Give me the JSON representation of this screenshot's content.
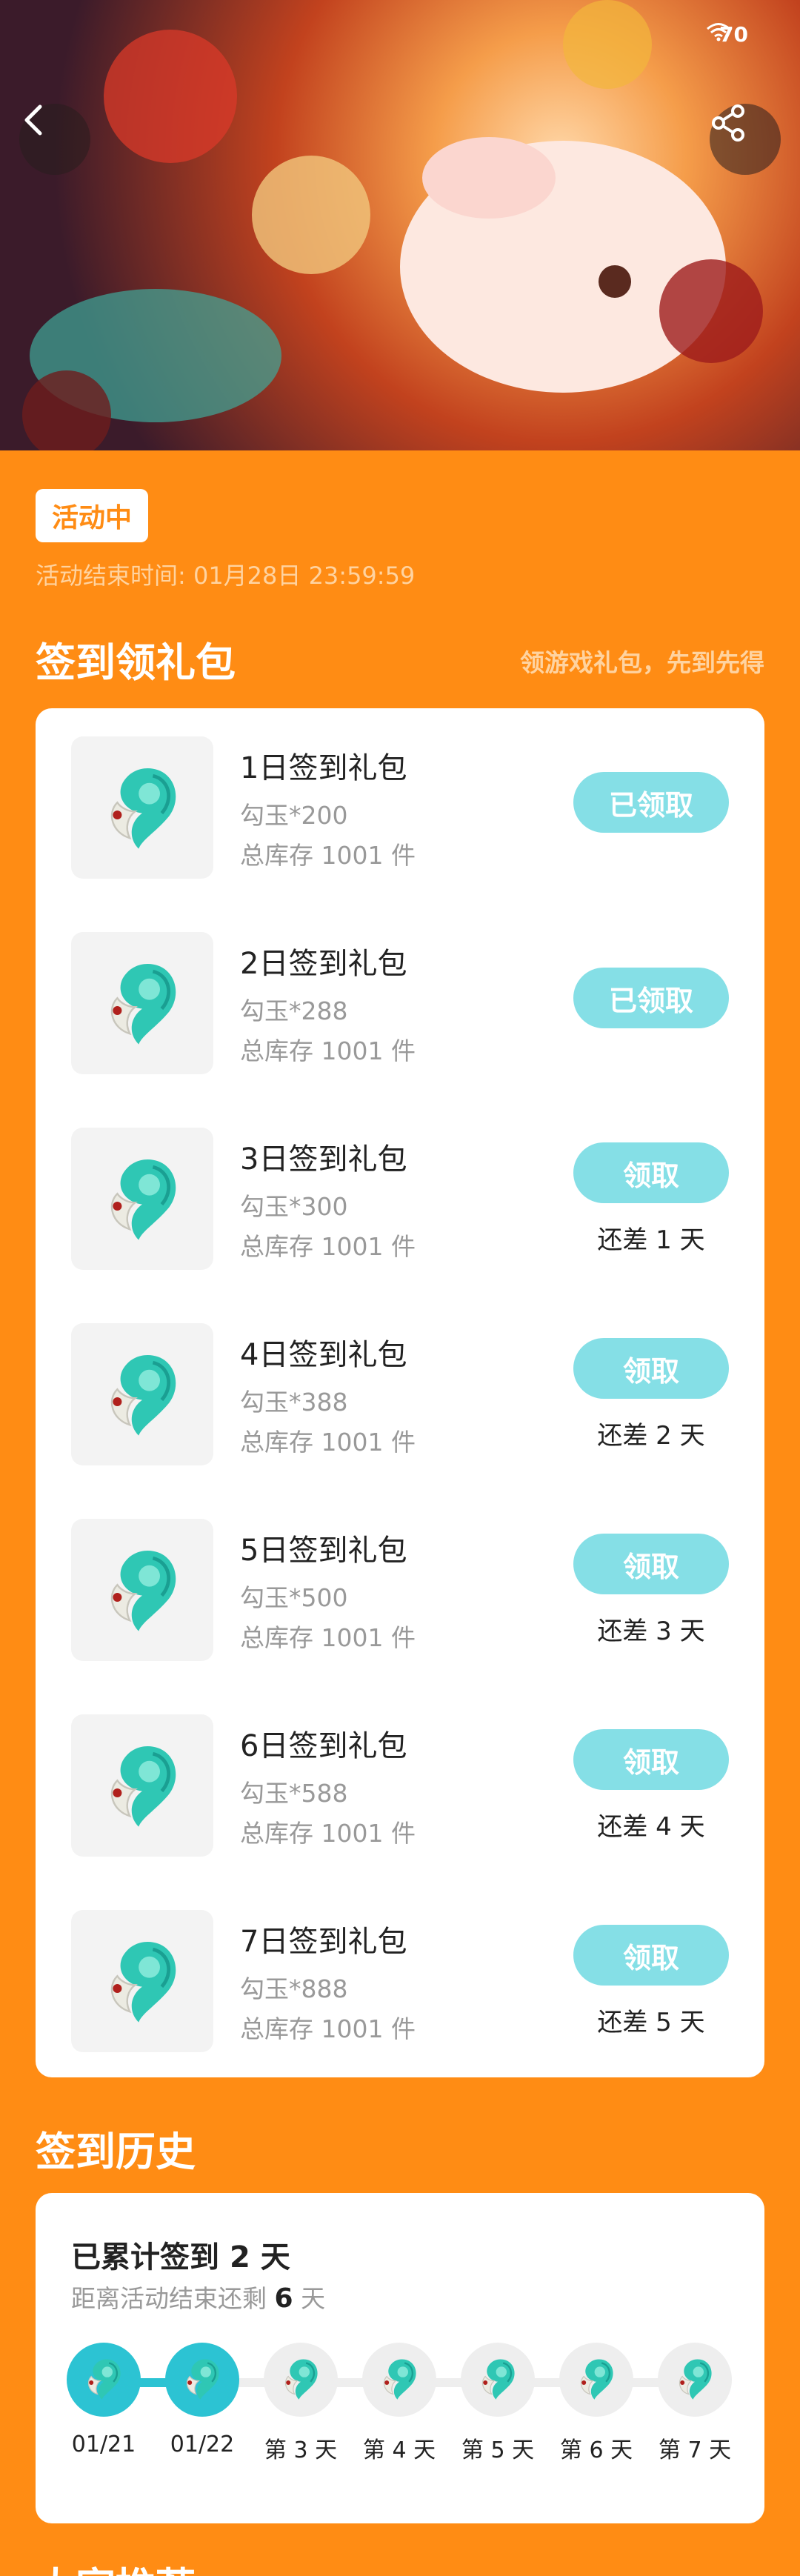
{
  "status_bar": {
    "battery": "70"
  },
  "banner": {
    "back_icon": "chevron-left-icon",
    "share_icon": "share-icon"
  },
  "activity": {
    "status": "活动中",
    "end_time": "活动结束时间: 01月28日 23:59:59"
  },
  "signin_section": {
    "title": "签到领礼包",
    "subtitle": "领游戏礼包，先到先得",
    "items": [
      {
        "name": "1日签到礼包",
        "item": "勾玉*200",
        "stock": "总库存 1001 件",
        "button": "已领取",
        "remaining": ""
      },
      {
        "name": "2日签到礼包",
        "item": "勾玉*288",
        "stock": "总库存 1001 件",
        "button": "已领取",
        "remaining": ""
      },
      {
        "name": "3日签到礼包",
        "item": "勾玉*300",
        "stock": "总库存 1001 件",
        "button": "领取",
        "remaining": "还差 1 天"
      },
      {
        "name": "4日签到礼包",
        "item": "勾玉*388",
        "stock": "总库存 1001 件",
        "button": "领取",
        "remaining": "还差 2 天"
      },
      {
        "name": "5日签到礼包",
        "item": "勾玉*500",
        "stock": "总库存 1001 件",
        "button": "领取",
        "remaining": "还差 3 天"
      },
      {
        "name": "6日签到礼包",
        "item": "勾玉*588",
        "stock": "总库存 1001 件",
        "button": "领取",
        "remaining": "还差 4 天"
      },
      {
        "name": "7日签到礼包",
        "item": "勾玉*888",
        "stock": "总库存 1001 件",
        "button": "领取",
        "remaining": "还差 5 天"
      }
    ]
  },
  "history_section": {
    "title": "签到历史",
    "total_prefix": "已累计签到",
    "total_days": "2 天",
    "left_prefix": "距离活动结束还剩",
    "left_days": "6",
    "left_suffix": "天",
    "days": [
      {
        "label": "01/21",
        "done": true
      },
      {
        "label": "01/22",
        "done": true
      },
      {
        "label": "第 3 天",
        "done": false
      },
      {
        "label": "第 4 天",
        "done": false
      },
      {
        "label": "第 5 天",
        "done": false
      },
      {
        "label": "第 6 天",
        "done": false
      },
      {
        "label": "第 7 天",
        "done": false
      }
    ]
  },
  "recommend_section": {
    "title": "大家推荐"
  },
  "colors": {
    "page_bg": "#ff8c14",
    "button": "#85dfe6",
    "signed": "#2cc3d3",
    "card": "#ffffff"
  }
}
